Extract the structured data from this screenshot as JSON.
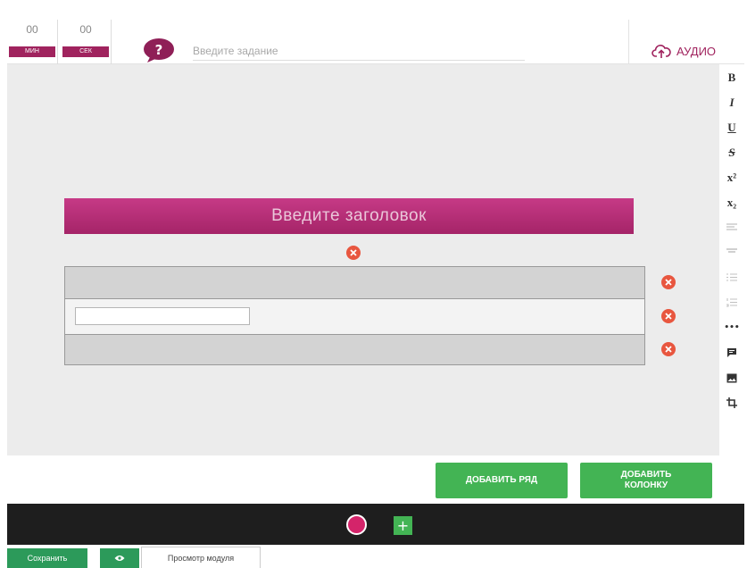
{
  "header": {
    "timer_minutes": {
      "value": "00",
      "label": "МИН"
    },
    "timer_seconds": {
      "value": "00",
      "label": "СЕК"
    },
    "task_placeholder": "Введите задание",
    "audio_label": "АУДИО"
  },
  "editor": {
    "title_placeholder": "Введите заголовок",
    "rows": 3
  },
  "toolbar": {
    "bold": "B",
    "italic": "I",
    "underline": "U",
    "strike": "S",
    "superscript": "x²",
    "subscript": "x₂",
    "more": "•••"
  },
  "actions": {
    "add_row": "ДОБАВИТЬ РЯД",
    "add_column": "ДОБАВИТЬ КОЛОНКУ"
  },
  "footer": {
    "save": "Сохранить",
    "preview_tab": "Просмотр модуля"
  },
  "colors": {
    "accent": "#a0235e",
    "green": "#43b454",
    "delete": "#e8563f",
    "dark_bar": "#1e1e1e"
  }
}
